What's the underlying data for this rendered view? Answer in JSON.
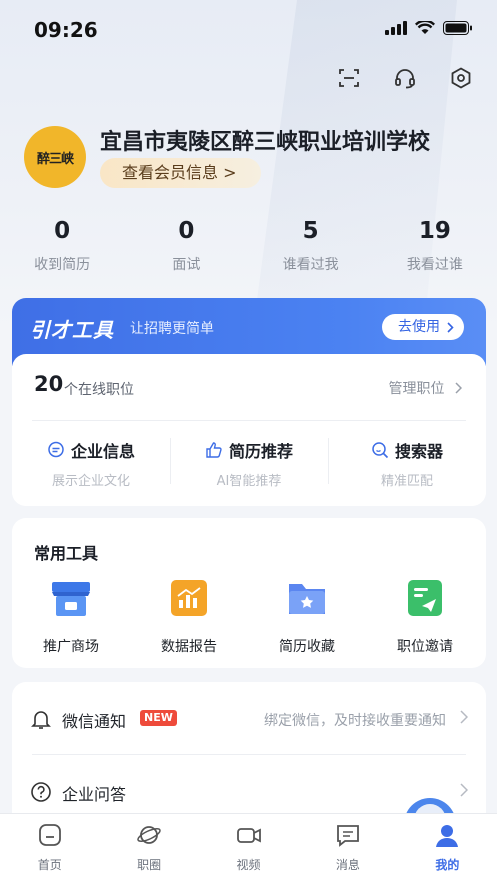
{
  "status_bar": {
    "time": "09:26"
  },
  "header": {
    "icons": [
      "scan-icon",
      "headset-icon",
      "settings-icon"
    ]
  },
  "profile": {
    "logo_text": "醉三峡",
    "company_name": "宜昌市夷陵区醉三峡职业培训学校",
    "member_button": "查看会员信息 >"
  },
  "stats": [
    {
      "value": "0",
      "label": "收到简历"
    },
    {
      "value": "0",
      "label": "面试"
    },
    {
      "value": "5",
      "label": "谁看过我"
    },
    {
      "value": "19",
      "label": "我看过谁"
    }
  ],
  "recruit_tools": {
    "title": "引才工具",
    "subtitle": "让招聘更简单",
    "go_button": "去使用",
    "job_count": "20",
    "job_count_label": "个在线职位",
    "manage_label": "管理职位",
    "features": [
      {
        "title": "企业信息",
        "sub": "展示企业文化",
        "icon": "chat-bubble-icon"
      },
      {
        "title": "简历推荐",
        "sub": "AI智能推荐",
        "icon": "thumbs-up-icon"
      },
      {
        "title": "搜索器",
        "sub": "精准匹配",
        "icon": "search-icon"
      }
    ]
  },
  "common_tools": {
    "title": "常用工具",
    "items": [
      {
        "label": "推广商场",
        "icon": "store-icon",
        "color": "#3d78e8"
      },
      {
        "label": "数据报告",
        "icon": "chart-report-icon",
        "color": "#f4a428"
      },
      {
        "label": "简历收藏",
        "icon": "folder-star-icon",
        "color": "#5b86f0"
      },
      {
        "label": "职位邀请",
        "icon": "send-invite-icon",
        "color": "#3bbf6a"
      }
    ]
  },
  "settings_list": [
    {
      "title": "微信通知",
      "badge": "NEW",
      "hint": "绑定微信，及时接收重要通知",
      "icon": "bell-icon"
    },
    {
      "title": "企业问答",
      "badge": "",
      "hint": "",
      "icon": "question-icon"
    }
  ],
  "tabbar": [
    {
      "label": "首页",
      "icon": "home-icon",
      "active": false
    },
    {
      "label": "职圈",
      "icon": "planet-icon",
      "active": false
    },
    {
      "label": "视频",
      "icon": "video-icon",
      "active": false
    },
    {
      "label": "消息",
      "icon": "message-icon",
      "active": false
    },
    {
      "label": "我的",
      "icon": "user-icon",
      "active": true
    }
  ],
  "colors": {
    "accent": "#3d6de6",
    "badge": "#ee4b3b",
    "logo_bg": "#f1b62a"
  }
}
